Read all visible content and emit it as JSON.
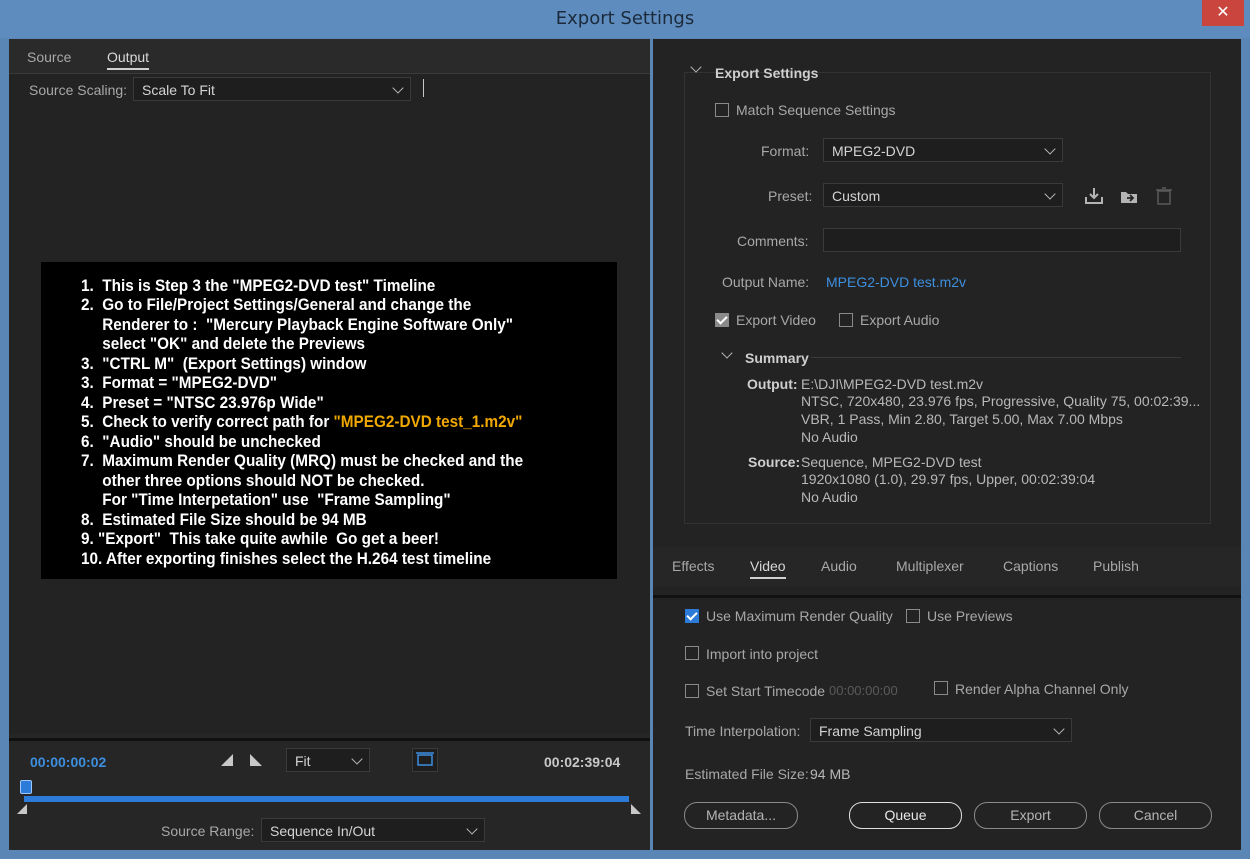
{
  "window": {
    "title": "Export Settings",
    "close_icon": "close-icon"
  },
  "left": {
    "tabs": [
      "Source",
      "Output"
    ],
    "active_tab": "Output",
    "source_scaling_label": "Source Scaling:",
    "source_scaling_value": "Scale To Fit",
    "video_lines": [
      "1.  This is Step 3 the \"MPEG2-DVD test\" Timeline",
      "2.  Go to File/Project Settings/General and change the",
      "     Renderer to :  \"Mercury Playback Engine Software Only\"",
      "     select \"OK\" and delete the Previews",
      "3.  \"CTRL M\"  (Export Settings) window",
      "3.  Format = \"MPEG2-DVD\"",
      "4.  Preset = \"NTSC 23.976p Wide\"",
      "5.  Check to verify correct path for ",
      "6.  \"Audio\" should be unchecked",
      "7.  Maximum Render Quality (MRQ) must be checked and the",
      "     other three options should NOT be checked.",
      "     For \"Time Interpetation\" use  \"Frame Sampling\"",
      "8.  Estimated File Size should be 94 MB",
      "9. \"Export\"  This take quite awhile  Go get a beer!",
      "10. After exporting finishes select the H.264 test timeline"
    ],
    "video_line_highlight": "\"MPEG2-DVD test_1.m2v\"",
    "timecode_current": "00:00:00:02",
    "timecode_total": "00:02:39:04",
    "zoom_value": "Fit",
    "source_range_label": "Source Range:",
    "source_range_value": "Sequence In/Out",
    "progress_fraction": 0.0
  },
  "right": {
    "section_title": "Export Settings",
    "match_sequence_label": "Match Sequence Settings",
    "format_label": "Format:",
    "format_value": "MPEG2-DVD",
    "preset_label": "Preset:",
    "preset_value": "Custom",
    "comments_label": "Comments:",
    "output_name_label": "Output Name:",
    "output_name_value": "MPEG2-DVD test.m2v",
    "export_video_label": "Export Video",
    "export_audio_label": "Export Audio",
    "summary_title": "Summary",
    "summary_output_label": "Output:",
    "summary_output_lines": [
      "E:\\DJI\\MPEG2-DVD test.m2v",
      "NTSC, 720x480, 23.976 fps, Progressive, Quality 75, 00:02:39...",
      "VBR, 1 Pass, Min 2.80, Target 5.00, Max 7.00 Mbps",
      "No Audio"
    ],
    "summary_source_label": "Source:",
    "summary_source_lines": [
      "Sequence, MPEG2-DVD test",
      "1920x1080 (1.0), 29.97 fps, Upper, 00:02:39:04",
      "No Audio"
    ],
    "tabs": [
      "Effects",
      "Video",
      "Audio",
      "Multiplexer",
      "Captions",
      "Publish"
    ],
    "active_tab": "Video",
    "use_max_render_label": "Use Maximum Render Quality",
    "use_previews_label": "Use Previews",
    "import_project_label": "Import into project",
    "set_start_tc_label": "Set Start Timecode",
    "start_tc_value": "00:00:00:00",
    "render_alpha_label": "Render Alpha Channel Only",
    "time_interp_label": "Time Interpolation:",
    "time_interp_value": "Frame Sampling",
    "est_size_label": "Estimated File Size:",
    "est_size_value": "94 MB",
    "buttons": {
      "metadata": "Metadata...",
      "queue": "Queue",
      "export": "Export",
      "cancel": "Cancel"
    }
  },
  "colors": {
    "accent": "#2c7bd8",
    "link": "#3d8fe0",
    "highlight": "#f0a800"
  }
}
